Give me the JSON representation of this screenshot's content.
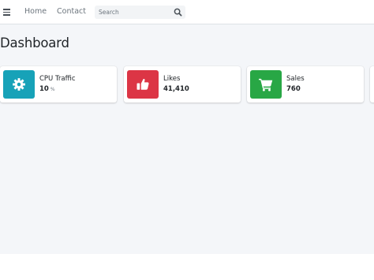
{
  "navbar": {
    "menu_icon": "hamburger-icon",
    "links": [
      {
        "label": "Home"
      },
      {
        "label": "Contact"
      }
    ],
    "search": {
      "placeholder": "Search",
      "value": "",
      "icon": "search-icon"
    }
  },
  "page": {
    "title": "Dashboard"
  },
  "info_boxes": [
    {
      "label": "CPU Traffic",
      "value": "10",
      "unit": "%",
      "icon": "gear-icon",
      "color": "#17a2b8"
    },
    {
      "label": "Likes",
      "value": "41,410",
      "unit": "",
      "icon": "thumbs-up-icon",
      "color": "#dc3545"
    },
    {
      "label": "Sales",
      "value": "760",
      "unit": "",
      "icon": "shopping-cart-icon",
      "color": "#28a745"
    }
  ],
  "colors": {
    "content_background": "#f4f6f9",
    "navbar_background": "#ffffff",
    "info_cyan": "#17a2b8",
    "info_red": "#dc3545",
    "info_green": "#28a745"
  }
}
